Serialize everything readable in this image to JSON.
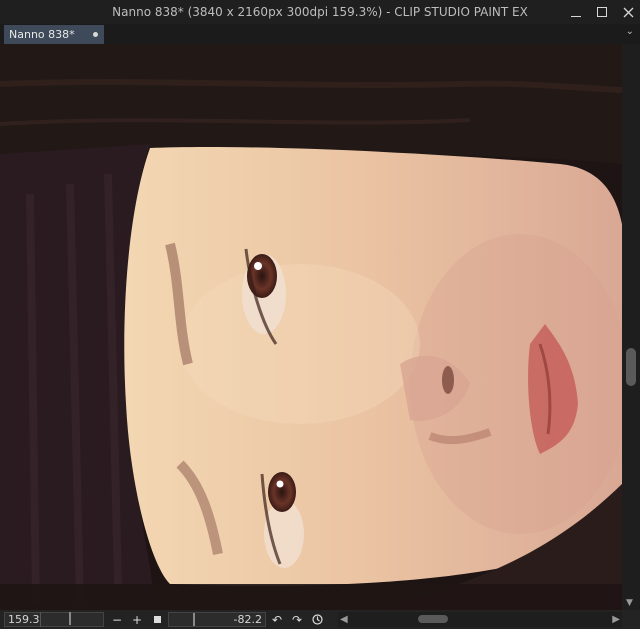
{
  "window": {
    "title": "Nanno 838* (3840 x 2160px 300dpi 159.3%)  - CLIP STUDIO PAINT EX"
  },
  "tabs": [
    {
      "label": "Nanno 838*",
      "modified": true
    }
  ],
  "status": {
    "zoom": "159.3",
    "rotation": "-82.2"
  },
  "icons": {
    "minimize": "minimize-icon",
    "maximize": "maximize-icon",
    "close": "close-icon",
    "zoom_out": "minus-icon",
    "zoom_in": "plus-icon",
    "fit": "square-icon",
    "rotate_left": "rotate-left-icon",
    "rotate_right": "rotate-right-icon",
    "reset_rotation": "reset-icon"
  },
  "colors": {
    "tab_active": "#3e4a5a",
    "hair": "#1c1110",
    "skin": "#e9c9a6"
  }
}
